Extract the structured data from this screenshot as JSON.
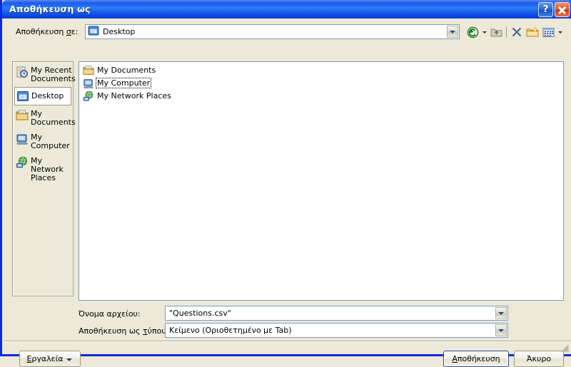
{
  "window": {
    "title": "Αποθήκευση ως",
    "help_button": "?",
    "close_button": "✕"
  },
  "lookin": {
    "label": "Αποθήκευση σε:",
    "label_accel": "σ",
    "value": "Desktop",
    "icon": "desktop-icon"
  },
  "toolbar": {
    "items": [
      {
        "name": "back-button",
        "icon": "back-arrow-icon"
      },
      {
        "name": "back-dropdown",
        "icon": "chevron-down-icon"
      },
      {
        "name": "up-one-level-button",
        "icon": "up-folder-icon"
      },
      {
        "name": "separator",
        "icon": "separator"
      },
      {
        "name": "delete-button",
        "icon": "delete-x-icon"
      },
      {
        "name": "new-folder-button",
        "icon": "new-folder-icon"
      },
      {
        "name": "views-button",
        "icon": "views-grid-icon"
      },
      {
        "name": "views-dropdown",
        "icon": "chevron-down-icon"
      }
    ]
  },
  "places": {
    "items": [
      {
        "label": "My Recent Documents",
        "icon": "recent-documents-icon",
        "selected": false
      },
      {
        "label": "Desktop",
        "icon": "desktop-icon",
        "selected": true
      },
      {
        "label": "My Documents",
        "icon": "my-documents-icon",
        "selected": false
      },
      {
        "label": "My Computer",
        "icon": "my-computer-icon",
        "selected": false
      },
      {
        "label": "My Network Places",
        "icon": "network-places-icon",
        "selected": false
      }
    ]
  },
  "filelist": {
    "items": [
      {
        "label": "My Documents",
        "icon": "my-documents-icon",
        "focused": false
      },
      {
        "label": "My Computer",
        "icon": "my-computer-icon",
        "focused": true
      },
      {
        "label": "My Network Places",
        "icon": "network-places-icon",
        "focused": false
      }
    ]
  },
  "fields": {
    "filename_label": "Όνομα αρχείου:",
    "filename_accel": "χ",
    "filename_value": "\"Questions.csv\"",
    "filetype_label": "Αποθήκευση ως τύπου:",
    "filetype_accel": "τ",
    "filetype_value": "Κείμενο (Οριοθετημένο με Tab)"
  },
  "buttons": {
    "tools": "Εργαλεία",
    "tools_accel": "Ε",
    "save": "Αποθήκευση",
    "save_accel": "Α",
    "cancel": "Άκυρο"
  },
  "colors": {
    "title_blue": "#0a46e8",
    "dialog_face": "#ece9d8",
    "field_border": "#7f9db9",
    "white": "#ffffff",
    "close_red": "#e2562f"
  }
}
